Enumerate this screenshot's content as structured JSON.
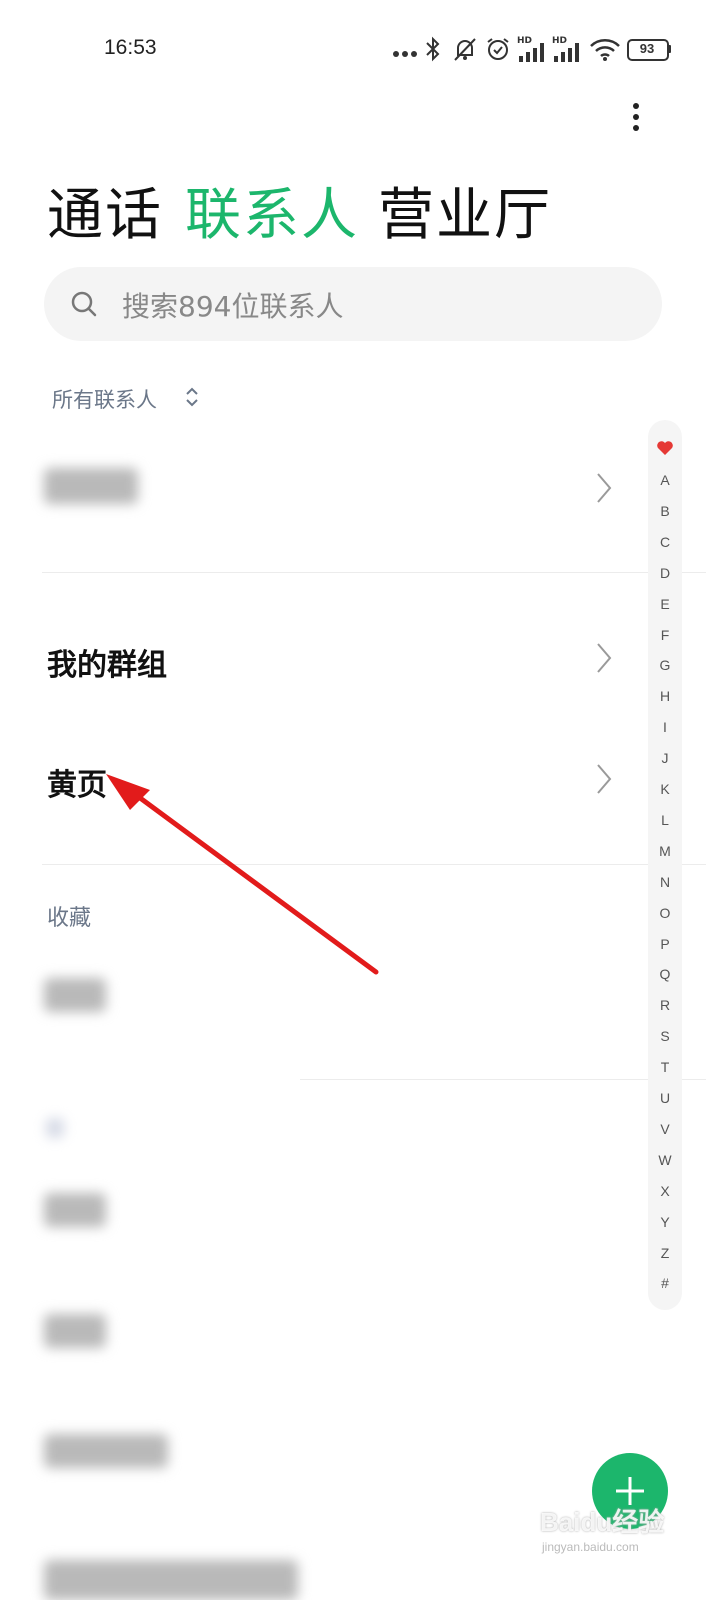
{
  "status_bar": {
    "time": "16:53",
    "battery": "93",
    "icons": [
      "more-dots-icon",
      "bluetooth-icon",
      "mute-bell-icon",
      "alarm-icon",
      "signal-hd-icon",
      "signal-hd-icon",
      "wifi-icon",
      "battery-icon"
    ],
    "hd_label": "HD"
  },
  "tabs": [
    {
      "label": "通话",
      "active": false
    },
    {
      "label": "联系人",
      "active": true
    },
    {
      "label": "营业厅",
      "active": false
    }
  ],
  "colors": {
    "accent": "#1cb66c",
    "inactive_tab": "#111111",
    "muted": "#6b7789"
  },
  "search": {
    "placeholder": "搜索894位联系人"
  },
  "filter": {
    "label": "所有联系人"
  },
  "groups": {
    "my_groups": "我的群组",
    "yellow_pages": "黄页"
  },
  "sections": {
    "favorites": "收藏"
  },
  "alphabet": [
    "A",
    "B",
    "C",
    "D",
    "E",
    "F",
    "G",
    "H",
    "I",
    "J",
    "K",
    "L",
    "M",
    "N",
    "O",
    "P",
    "Q",
    "R",
    "S",
    "T",
    "U",
    "V",
    "W",
    "X",
    "Y",
    "Z",
    "#"
  ],
  "watermark": {
    "text": "Baidu经验",
    "url": "jingyan.baidu.com"
  }
}
